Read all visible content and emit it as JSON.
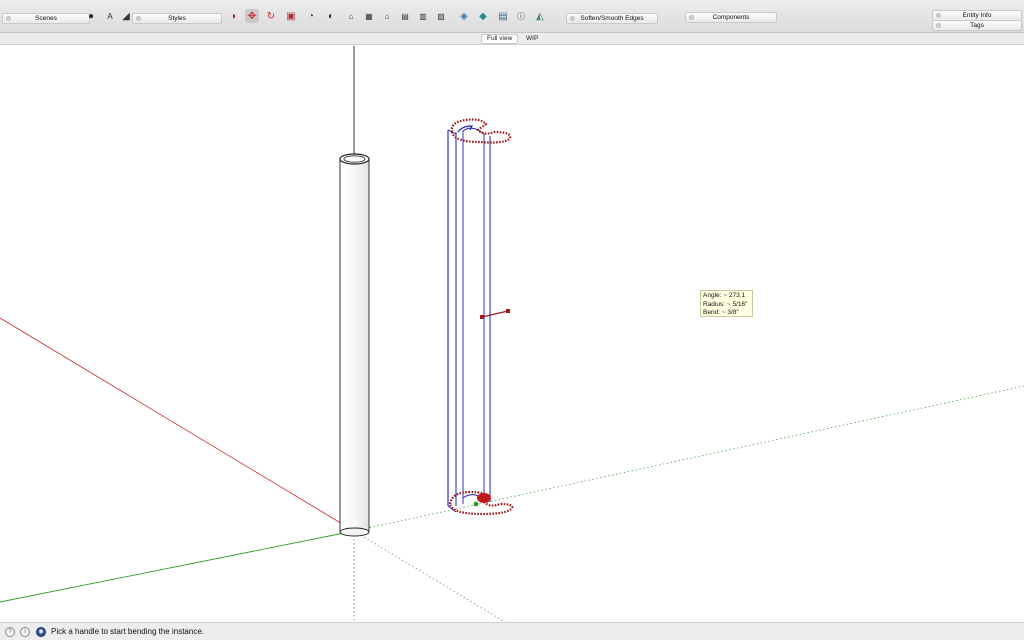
{
  "toolbar": {
    "panels": {
      "scenes": "Scenes",
      "styles": "Styles",
      "soften": "Soften/Smooth Edges",
      "components": "Components",
      "entity_info": "Entity Info",
      "tags": "Tags"
    },
    "tool_icons": [
      "select-icon",
      "text-icon",
      "paint-icon",
      "arc-icon",
      "move-icon",
      "rotate-icon",
      "scale-icon",
      "offset-icon",
      "camera-icon",
      "view-iso-icon",
      "view-top-icon",
      "view-front-icon",
      "view-right-icon",
      "view-back-icon",
      "view-left-icon",
      "section-icon",
      "layers-icon",
      "stack-icon",
      "info-icon",
      "extension-icon"
    ]
  },
  "view_tabs": {
    "full_view": "Full view",
    "wip": "WIP"
  },
  "tooltip": {
    "angle": "Angle: ~ 273.1",
    "radius": "Radius: ~ 5/16\"",
    "bend": "Bend: ~ 3/8\""
  },
  "status": {
    "message": "Pick a handle to start bending the instance.",
    "icons": [
      "help-icon",
      "info-icon",
      "globe-icon"
    ]
  },
  "colors": {
    "x_axis": "#c62828",
    "y_axis": "#2e9e2e",
    "z_axis": "#000000",
    "selection": "#1f1fb4",
    "handle": "#a01818",
    "tooltip_bg": "#ffffe1"
  }
}
